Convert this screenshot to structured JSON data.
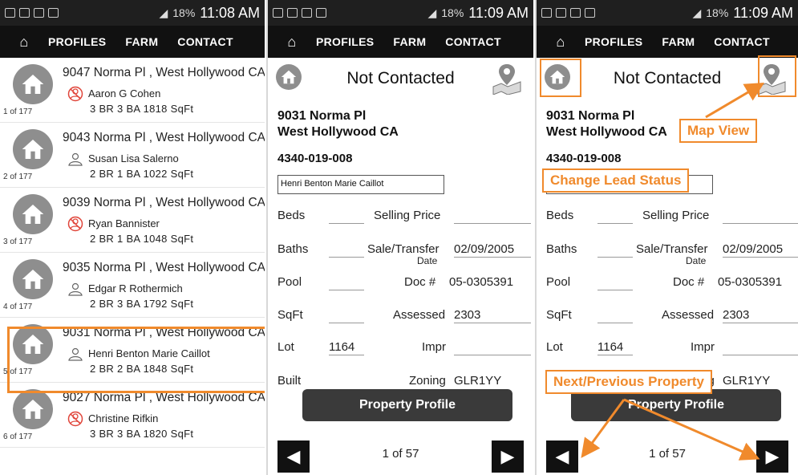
{
  "status_bar": [
    {
      "battery": "18%",
      "time": "11:08 AM"
    },
    {
      "battery": "18%",
      "time": "11:09 AM"
    },
    {
      "battery": "18%",
      "time": "11:09 AM"
    }
  ],
  "nav": {
    "profiles": "PROFILES",
    "farm": "FARM",
    "contact": "CONTACT"
  },
  "list": [
    {
      "addr": "9047 Norma Pl , West Hollywood CA",
      "owner": "Aaron G Cohen",
      "stats": "3 BR  3 BA  1818 SqFt",
      "count": "1 of 177",
      "status": "not-contacted"
    },
    {
      "addr": "9043 Norma Pl , West Hollywood CA",
      "owner": "Susan Lisa Salerno",
      "stats": "2 BR  1 BA  1022 SqFt",
      "count": "2 of 177",
      "status": "person"
    },
    {
      "addr": "9039 Norma Pl , West Hollywood CA",
      "owner": "Ryan Bannister",
      "stats": "2 BR  1 BA  1048 SqFt",
      "count": "3 of 177",
      "status": "not-contacted"
    },
    {
      "addr": "9035 Norma Pl , West Hollywood CA",
      "owner": "Edgar R Rothermich",
      "stats": "2 BR  3 BA  1792 SqFt",
      "count": "4 of 177",
      "status": "person"
    },
    {
      "addr": "9031 Norma Pl , West Hollywood CA",
      "owner": "Henri Benton Marie Caillot",
      "stats": "2 BR  2 BA  1848 SqFt",
      "count": "5 of 177",
      "status": "person"
    },
    {
      "addr": "9027 Norma Pl , West Hollywood CA",
      "owner": "Christine Rifkin",
      "stats": "3 BR  3 BA  1820 SqFt",
      "count": "6 of 177",
      "status": "not-contacted"
    }
  ],
  "detail": {
    "title": "Not Contacted",
    "street": "9031 Norma Pl",
    "city": "West Hollywood CA",
    "apn": "4340-019-008",
    "owner": "Henri Benton Marie Caillot",
    "beds_label": "Beds",
    "beds": "",
    "baths_label": "Baths",
    "baths": "",
    "pool_label": "Pool",
    "pool": "",
    "sqft_label": "SqFt",
    "sqft": "",
    "lot_label": "Lot",
    "lot": "1164",
    "built_label": "Built",
    "built": "",
    "selling_price_label": "Selling Price",
    "selling_price": "",
    "sale_label": "Sale/Transfer",
    "sale_label2": "Date",
    "sale_date": "02/09/2005",
    "doc_label": "Doc #",
    "doc": "05-0305391",
    "assessed_label": "Assessed",
    "assessed": "2303",
    "impr_label": "Impr",
    "impr": "",
    "zoning_label": "Zoning",
    "zoning": "GLR1YY",
    "profile_button": "Property Profile",
    "pager": "1 of 57"
  },
  "annotations": {
    "map_view": "Map View",
    "change_status": "Change Lead Status",
    "next_prev": "Next/Previous Property"
  },
  "colors": {
    "annotation": "#f08a2c",
    "nav_bg": "#111111",
    "button_bg": "#3a3a3a"
  }
}
